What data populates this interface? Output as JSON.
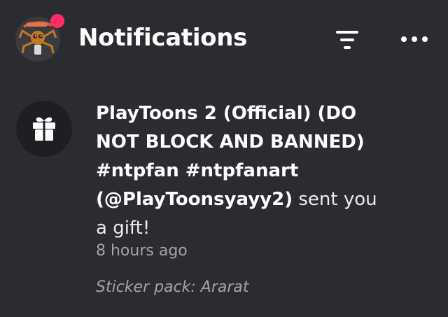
{
  "header": {
    "title": "Notifications",
    "avatar_icon": "user-avatar-spider-character",
    "badge_color": "#ff2d63",
    "filter_icon": "filter-lines-icon",
    "more_icon": "more-dots-icon"
  },
  "notification": {
    "icon": "gift-icon",
    "sender": "PlayToons 2 (Official) (DO NOT BLOCK AND BANNED) #ntpfan #ntpfanart (@PlayToonsyayy2)",
    "action": "sent you a gift!",
    "time": "8 hours ago",
    "detail": "Sticker pack: Ararat"
  },
  "colors": {
    "background": "#2b2c30",
    "icon_circle": "#1e1f22",
    "muted_text": "#a3a4a8"
  }
}
